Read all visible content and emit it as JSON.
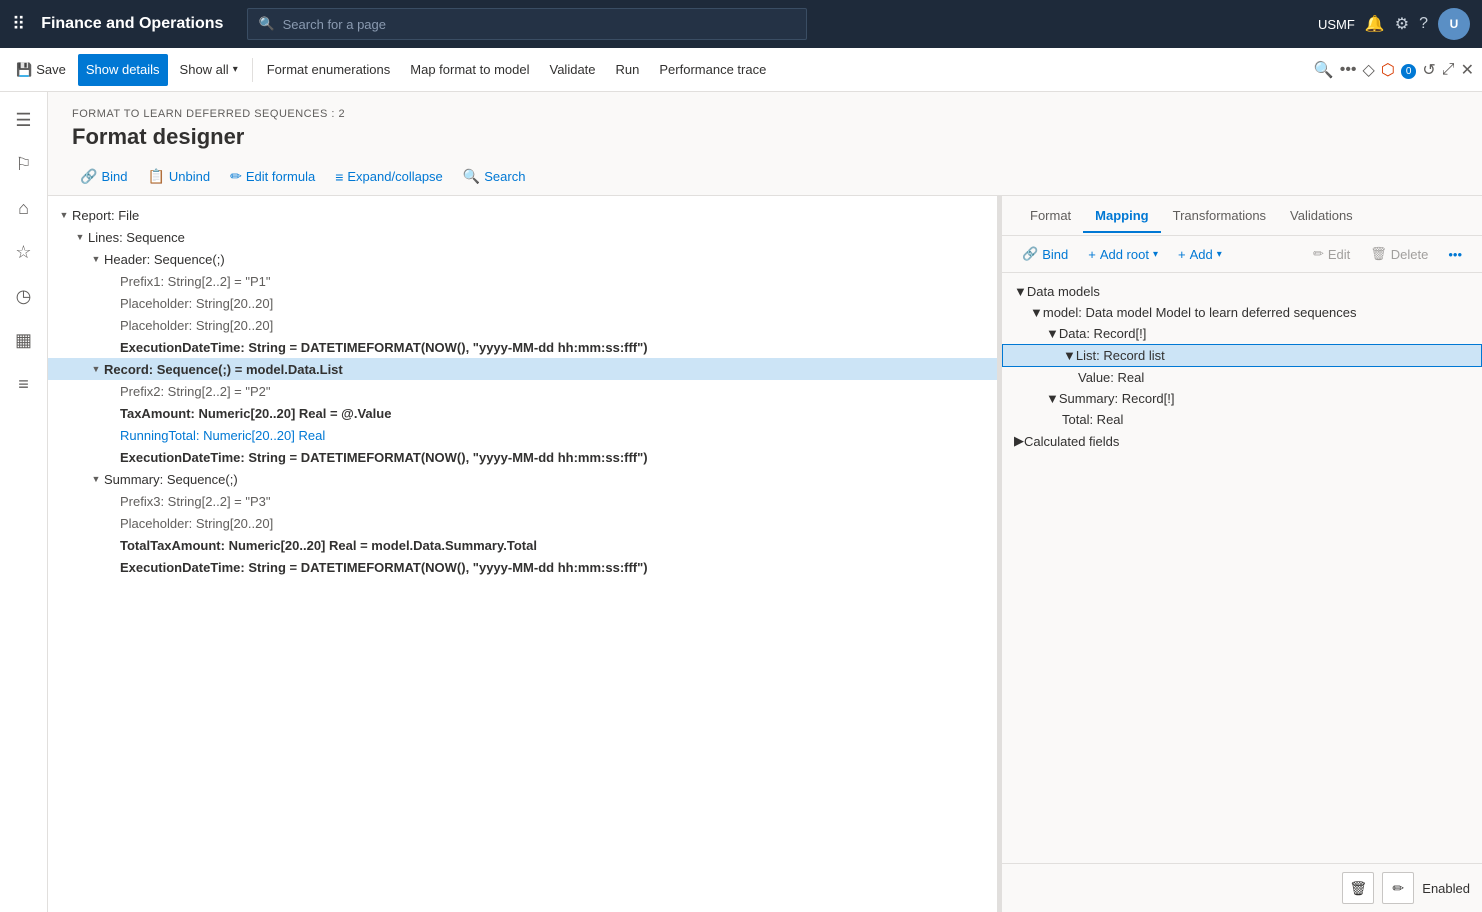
{
  "app": {
    "title": "Finance and Operations",
    "search_placeholder": "Search for a page",
    "user_org": "USMF"
  },
  "command_bar": {
    "save_label": "Save",
    "show_details_label": "Show details",
    "show_all_label": "Show all",
    "format_enumerations_label": "Format enumerations",
    "map_format_to_model_label": "Map format to model",
    "validate_label": "Validate",
    "run_label": "Run",
    "performance_trace_label": "Performance trace"
  },
  "page": {
    "breadcrumb": "FORMAT TO LEARN DEFERRED SEQUENCES : 2",
    "title": "Format designer"
  },
  "format_toolbar": {
    "bind_label": "Bind",
    "unbind_label": "Unbind",
    "edit_formula_label": "Edit formula",
    "expand_collapse_label": "Expand/collapse",
    "search_label": "Search"
  },
  "left_tree": {
    "items": [
      {
        "indent": 0,
        "expand": "▼",
        "text": "Report: File",
        "style": "normal",
        "selected": false
      },
      {
        "indent": 1,
        "expand": "▼",
        "text": "Lines: Sequence",
        "style": "normal",
        "selected": false
      },
      {
        "indent": 2,
        "expand": "▼",
        "text": "Header: Sequence(;)",
        "style": "normal",
        "selected": false
      },
      {
        "indent": 3,
        "expand": "",
        "text": "Prefix1: String[2..2] = \"P1\"",
        "style": "light",
        "selected": false
      },
      {
        "indent": 3,
        "expand": "",
        "text": "Placeholder: String[20..20]",
        "style": "light",
        "selected": false
      },
      {
        "indent": 3,
        "expand": "",
        "text": "Placeholder: String[20..20]",
        "style": "light",
        "selected": false
      },
      {
        "indent": 3,
        "expand": "",
        "text": "ExecutionDateTime: String = DATETIMEFORMAT(NOW(), \"yyyy-MM-dd hh:mm:ss:fff\")",
        "style": "bold",
        "selected": false
      },
      {
        "indent": 2,
        "expand": "▼",
        "text": "Record: Sequence(;) = model.Data.List",
        "style": "bold",
        "selected": true
      },
      {
        "indent": 3,
        "expand": "",
        "text": "Prefix2: String[2..2] = \"P2\"",
        "style": "light",
        "selected": false
      },
      {
        "indent": 3,
        "expand": "",
        "text": "TaxAmount: Numeric[20..20] Real = @.Value",
        "style": "bold",
        "selected": false
      },
      {
        "indent": 3,
        "expand": "",
        "text": "RunningTotal: Numeric[20..20] Real",
        "style": "blue",
        "selected": false
      },
      {
        "indent": 3,
        "expand": "",
        "text": "ExecutionDateTime: String = DATETIMEFORMAT(NOW(), \"yyyy-MM-dd hh:mm:ss:fff\")",
        "style": "bold",
        "selected": false
      },
      {
        "indent": 2,
        "expand": "▼",
        "text": "Summary: Sequence(;)",
        "style": "normal",
        "selected": false
      },
      {
        "indent": 3,
        "expand": "",
        "text": "Prefix3: String[2..2] = \"P3\"",
        "style": "light",
        "selected": false
      },
      {
        "indent": 3,
        "expand": "",
        "text": "Placeholder: String[20..20]",
        "style": "light",
        "selected": false
      },
      {
        "indent": 3,
        "expand": "",
        "text": "TotalTaxAmount: Numeric[20..20] Real = model.Data.Summary.Total",
        "style": "bold",
        "selected": false
      },
      {
        "indent": 3,
        "expand": "",
        "text": "ExecutionDateTime: String = DATETIMEFORMAT(NOW(), \"yyyy-MM-dd hh:mm:ss:fff\")",
        "style": "bold",
        "selected": false
      }
    ]
  },
  "right_pane": {
    "tabs": [
      {
        "id": "format",
        "label": "Format",
        "active": false
      },
      {
        "id": "mapping",
        "label": "Mapping",
        "active": true
      },
      {
        "id": "transformations",
        "label": "Transformations",
        "active": false
      },
      {
        "id": "validations",
        "label": "Validations",
        "active": false
      }
    ],
    "toolbar": {
      "bind_label": "Bind",
      "add_root_label": "Add root",
      "add_label": "Add",
      "edit_label": "Edit",
      "delete_label": "Delete"
    },
    "tree": {
      "items": [
        {
          "indent": 0,
          "expand": "▼",
          "text": "Data models",
          "style": "normal",
          "selected": false
        },
        {
          "indent": 1,
          "expand": "▼",
          "text": "model: Data model Model to learn deferred sequences",
          "style": "normal",
          "selected": false
        },
        {
          "indent": 2,
          "expand": "▼",
          "text": "Data: Record[!]",
          "style": "normal",
          "selected": false
        },
        {
          "indent": 3,
          "expand": "▼",
          "text": "List: Record list",
          "style": "normal",
          "selected": true
        },
        {
          "indent": 4,
          "expand": "",
          "text": "Value: Real",
          "style": "normal",
          "selected": false
        },
        {
          "indent": 2,
          "expand": "▼",
          "text": "Summary: Record[!]",
          "style": "normal",
          "selected": false
        },
        {
          "indent": 3,
          "expand": "",
          "text": "Total: Real",
          "style": "normal",
          "selected": false
        },
        {
          "indent": 0,
          "expand": "▶",
          "text": "Calculated fields",
          "style": "normal",
          "selected": false
        }
      ]
    },
    "status": "Enabled"
  },
  "sidebar": {
    "icons": [
      {
        "name": "hamburger-icon",
        "symbol": "☰"
      },
      {
        "name": "home-icon",
        "symbol": "⌂"
      },
      {
        "name": "favorites-icon",
        "symbol": "☆"
      },
      {
        "name": "recent-icon",
        "symbol": "◷"
      },
      {
        "name": "workspaces-icon",
        "symbol": "⊞"
      },
      {
        "name": "modules-icon",
        "symbol": "≡"
      }
    ]
  }
}
